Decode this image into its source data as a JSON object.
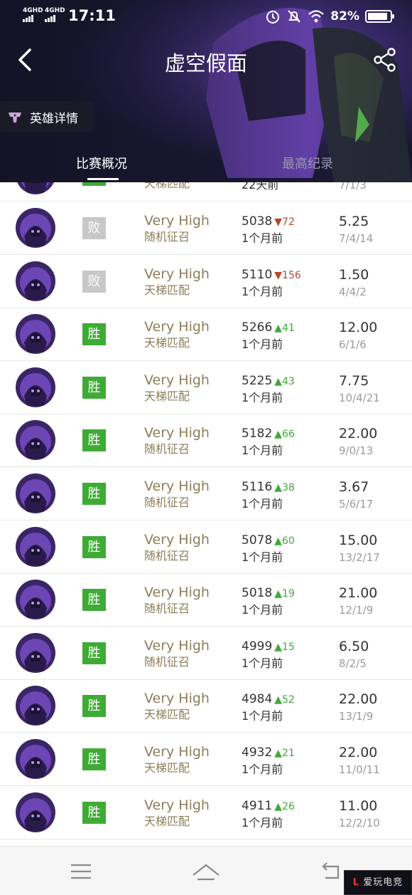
{
  "status_bar": {
    "signal_1": "4GHD",
    "signal_2": "4GHD",
    "time": "17:11",
    "battery": "82%"
  },
  "header": {
    "title": "虚空假面",
    "hero_detail_label": "英雄详情",
    "tabs": [
      {
        "label": "比赛概况",
        "active": true
      },
      {
        "label": "最高纪录",
        "active": false
      }
    ]
  },
  "partial_top_row": {
    "mode": "天梯匹配",
    "ago": "22天前",
    "kda_detail": "7/1/3"
  },
  "matches": [
    {
      "result": "败",
      "win": false,
      "skill": "Very High",
      "mode": "随机征召",
      "mmr": "5038",
      "delta": "72",
      "delta_dir": "down",
      "ago": "1个月前",
      "kda": "5.25",
      "kda_detail": "7/4/14"
    },
    {
      "result": "败",
      "win": false,
      "skill": "Very High",
      "mode": "天梯匹配",
      "mmr": "5110",
      "delta": "156",
      "delta_dir": "down",
      "ago": "1个月前",
      "kda": "1.50",
      "kda_detail": "4/4/2"
    },
    {
      "result": "胜",
      "win": true,
      "skill": "Very High",
      "mode": "天梯匹配",
      "mmr": "5266",
      "delta": "41",
      "delta_dir": "up",
      "ago": "1个月前",
      "kda": "12.00",
      "kda_detail": "6/1/6"
    },
    {
      "result": "胜",
      "win": true,
      "skill": "Very High",
      "mode": "天梯匹配",
      "mmr": "5225",
      "delta": "43",
      "delta_dir": "up",
      "ago": "1个月前",
      "kda": "7.75",
      "kda_detail": "10/4/21"
    },
    {
      "result": "胜",
      "win": true,
      "skill": "Very High",
      "mode": "随机征召",
      "mmr": "5182",
      "delta": "66",
      "delta_dir": "up",
      "ago": "1个月前",
      "kda": "22.00",
      "kda_detail": "9/0/13"
    },
    {
      "result": "胜",
      "win": true,
      "skill": "Very High",
      "mode": "随机征召",
      "mmr": "5116",
      "delta": "38",
      "delta_dir": "up",
      "ago": "1个月前",
      "kda": "3.67",
      "kda_detail": "5/6/17"
    },
    {
      "result": "胜",
      "win": true,
      "skill": "Very High",
      "mode": "随机征召",
      "mmr": "5078",
      "delta": "60",
      "delta_dir": "up",
      "ago": "1个月前",
      "kda": "15.00",
      "kda_detail": "13/2/17"
    },
    {
      "result": "胜",
      "win": true,
      "skill": "Very High",
      "mode": "随机征召",
      "mmr": "5018",
      "delta": "19",
      "delta_dir": "up",
      "ago": "1个月前",
      "kda": "21.00",
      "kda_detail": "12/1/9"
    },
    {
      "result": "胜",
      "win": true,
      "skill": "Very High",
      "mode": "随机征召",
      "mmr": "4999",
      "delta": "15",
      "delta_dir": "up",
      "ago": "1个月前",
      "kda": "6.50",
      "kda_detail": "8/2/5"
    },
    {
      "result": "胜",
      "win": true,
      "skill": "Very High",
      "mode": "天梯匹配",
      "mmr": "4984",
      "delta": "52",
      "delta_dir": "up",
      "ago": "1个月前",
      "kda": "22.00",
      "kda_detail": "13/1/9"
    },
    {
      "result": "胜",
      "win": true,
      "skill": "Very High",
      "mode": "天梯匹配",
      "mmr": "4932",
      "delta": "21",
      "delta_dir": "up",
      "ago": "1个月前",
      "kda": "22.00",
      "kda_detail": "11/0/11"
    },
    {
      "result": "胜",
      "win": true,
      "skill": "Very High",
      "mode": "天梯匹配",
      "mmr": "4911",
      "delta": "26",
      "delta_dir": "up",
      "ago": "1个月前",
      "kda": "11.00",
      "kda_detail": "12/2/10"
    }
  ],
  "icons": {
    "back": "back-arrow-icon",
    "share": "share-icon",
    "hero_detail": "hero-helmet-icon",
    "menu": "menu-icon",
    "home": "home-icon",
    "return": "return-icon"
  },
  "watermark": "爱玩电竞",
  "colors": {
    "win": "#3eab35",
    "loss": "#c8c8c8",
    "delta_up": "#3eab35",
    "delta_down": "#b9462e",
    "skill_text": "#8c7d58"
  }
}
